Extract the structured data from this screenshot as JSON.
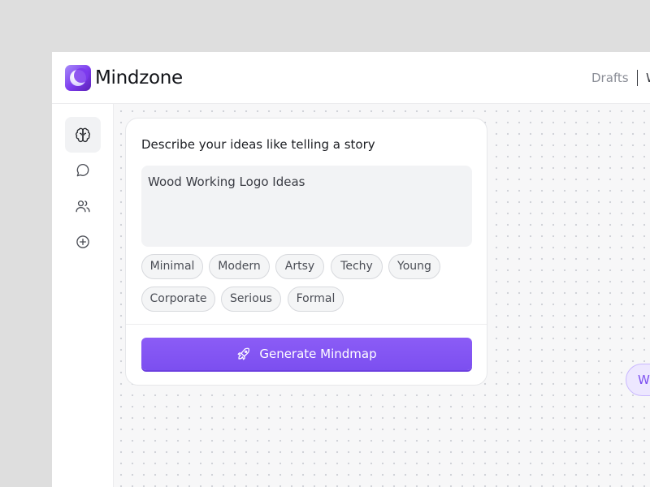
{
  "app": {
    "name": "Mindzone",
    "nav": {
      "drafts": "Drafts",
      "next_partial": "W"
    }
  },
  "sidebar": {
    "items": [
      {
        "id": "mindmap",
        "icon": "brain-icon",
        "active": true
      },
      {
        "id": "chat",
        "icon": "chat-bubble-icon",
        "active": false
      },
      {
        "id": "team",
        "icon": "users-icon",
        "active": false
      },
      {
        "id": "add",
        "icon": "plus-circle-icon",
        "active": false
      }
    ]
  },
  "card": {
    "title": "Describe your ideas like telling a story",
    "prompt_value": "Wood Working Logo Ideas",
    "tags": [
      "Minimal",
      "Modern",
      "Artsy",
      "Techy",
      "Young",
      "Corporate",
      "Serious",
      "Formal"
    ],
    "generate_label": "Generate Mindmap",
    "generate_icon": "rocket-icon"
  },
  "canvas": {
    "node_partial_label": "W"
  },
  "colors": {
    "accent": "#8b5cf6",
    "accent_soft": "#ede7ff",
    "canvas_bg": "#f7f7f8"
  }
}
